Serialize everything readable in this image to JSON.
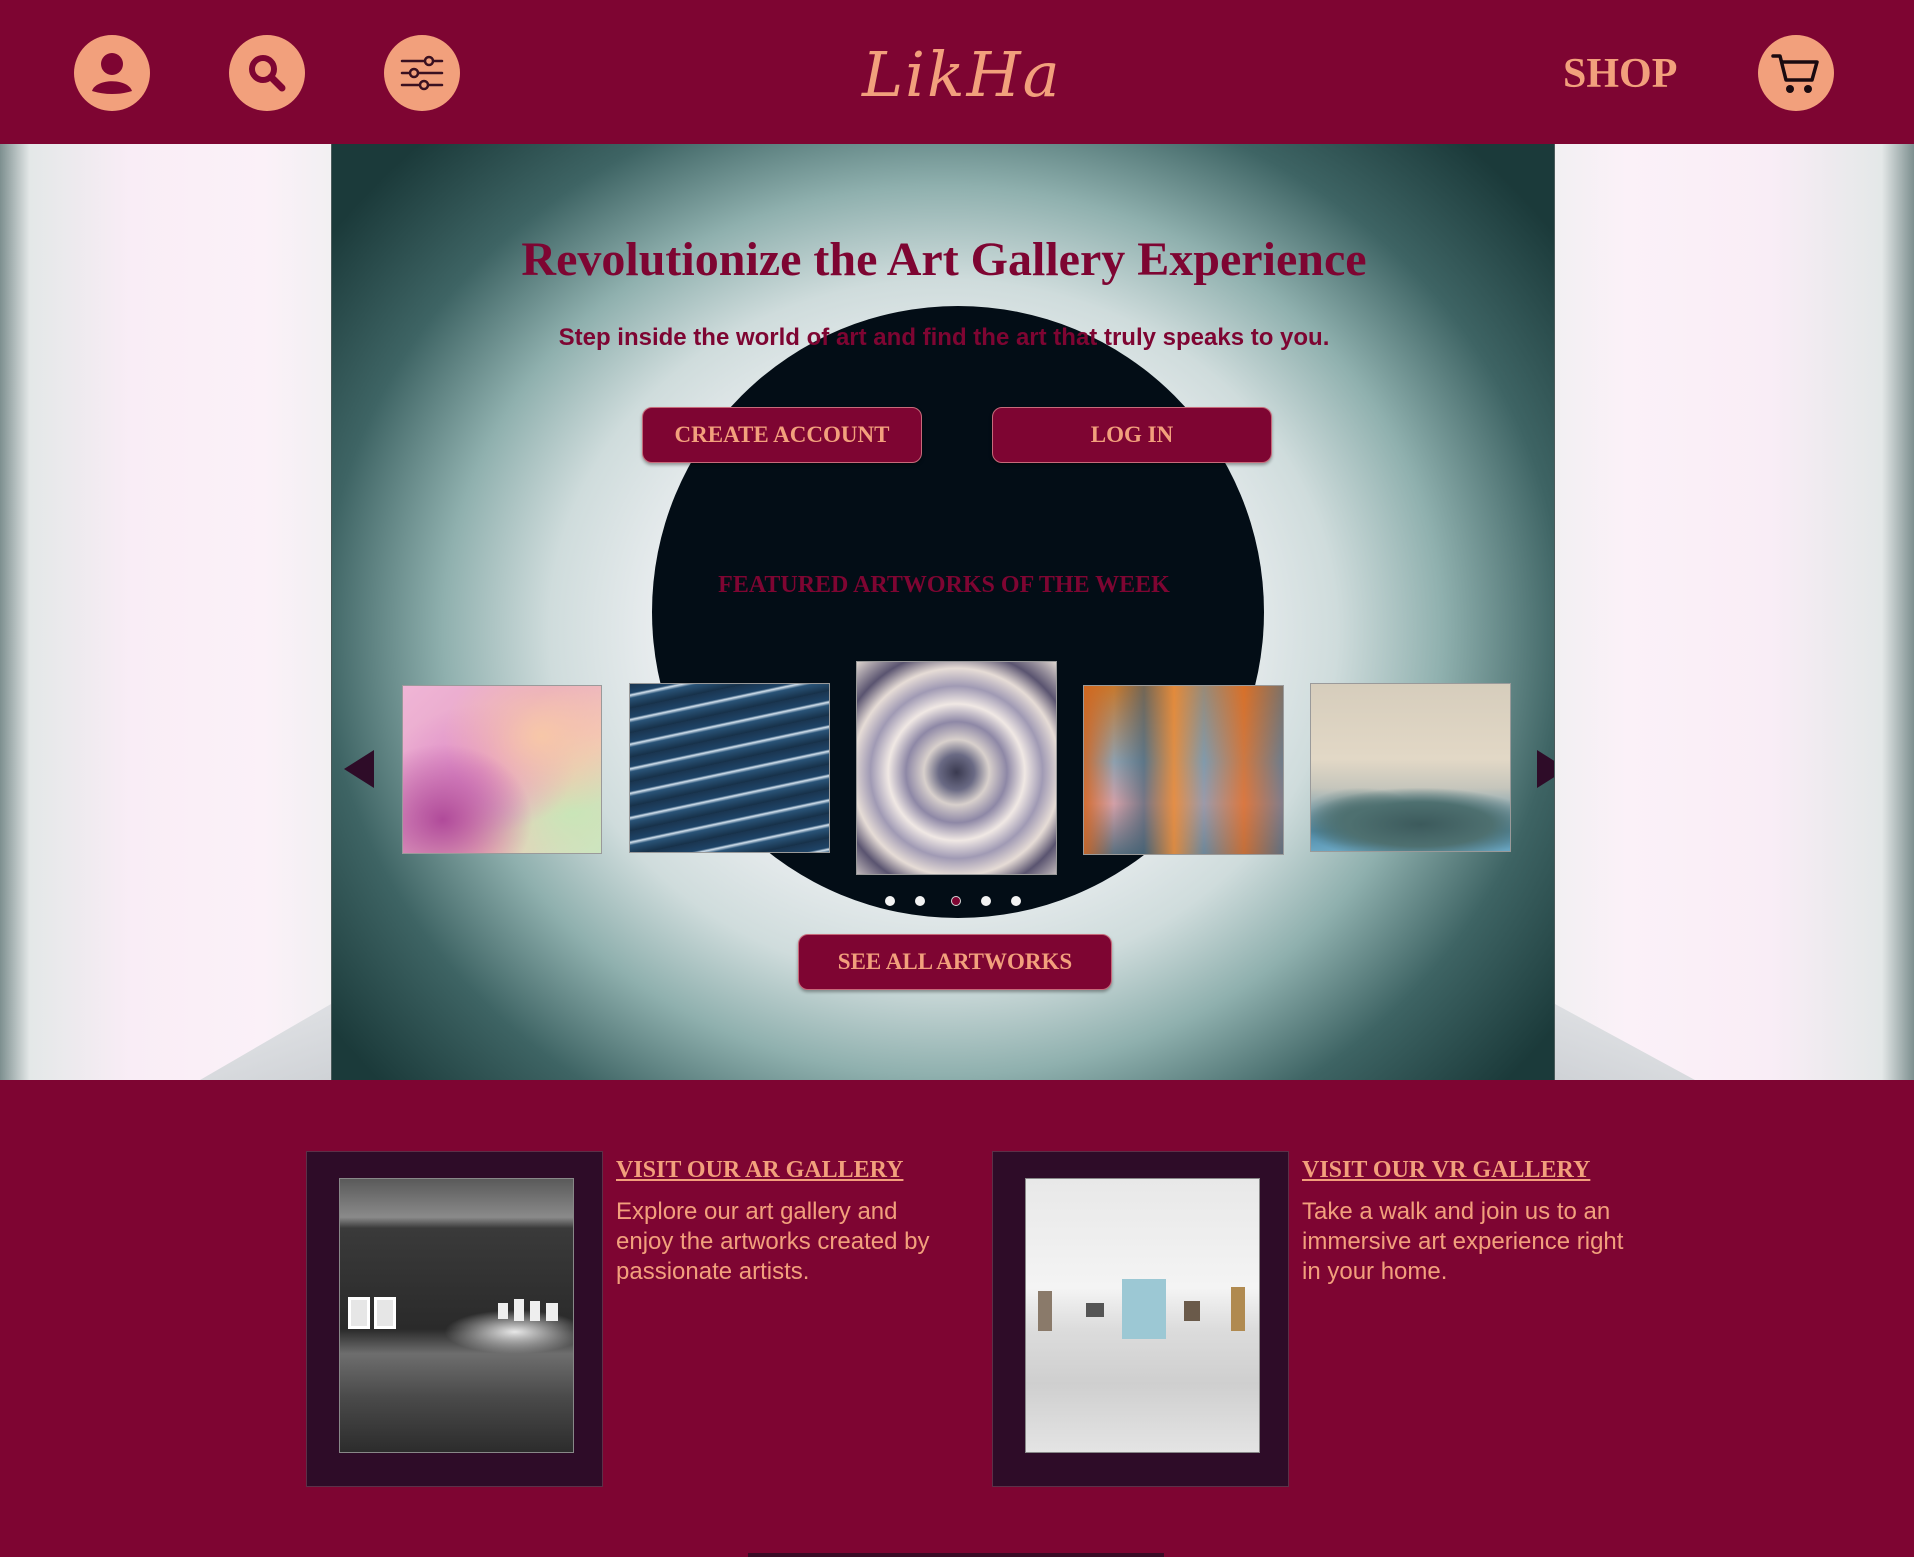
{
  "header": {
    "logo": "LikHa",
    "shop_label": "SHOP",
    "icons": [
      "user-icon",
      "search-icon",
      "filter-icon",
      "cart-icon"
    ]
  },
  "hero": {
    "title": "Revolutionize the Art Gallery Experience",
    "subtitle": "Step inside the world of art and find the art that truly speaks to you.",
    "create_account_label": "CREATE ACCOUNT",
    "login_label": "LOG IN",
    "featured_title": "FEATURED ARTWORKS OF THE WEEK",
    "see_all_label": "SEE ALL ARTWORKS",
    "carousel": {
      "active_dot": 3,
      "dot_count": 5
    }
  },
  "galleries": {
    "ar": {
      "title": "VISIT OUR AR GALLERY",
      "description": "Explore our art gallery and enjoy the artworks created by passionate artists."
    },
    "vr": {
      "title": "VISIT OUR VR GALLERY",
      "description": "Take a walk and join us to an immersive art experience right in your home."
    }
  },
  "colors": {
    "brand": "#7e0532",
    "accent": "#f2a07c",
    "card_bg": "#2e0c28"
  }
}
